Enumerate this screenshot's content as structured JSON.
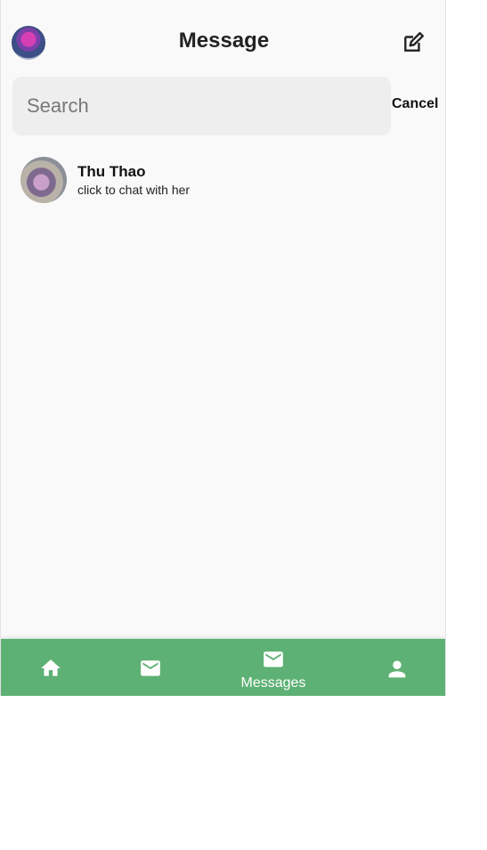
{
  "header": {
    "title": "Message",
    "avatar_icon": "user-avatar",
    "compose_icon": "edit-icon"
  },
  "search": {
    "placeholder": "Search",
    "value": "",
    "cancel_label": "Cancel"
  },
  "conversations": [
    {
      "name": "Thu Thao",
      "subtitle": "click to chat with her"
    }
  ],
  "tabbar": {
    "background": "#5eb174",
    "tabs": [
      {
        "icon": "home-icon",
        "label": ""
      },
      {
        "icon": "mail-icon",
        "label": ""
      },
      {
        "icon": "mail-icon",
        "label": "Messages",
        "active": true
      },
      {
        "icon": "person-icon",
        "label": ""
      }
    ]
  }
}
